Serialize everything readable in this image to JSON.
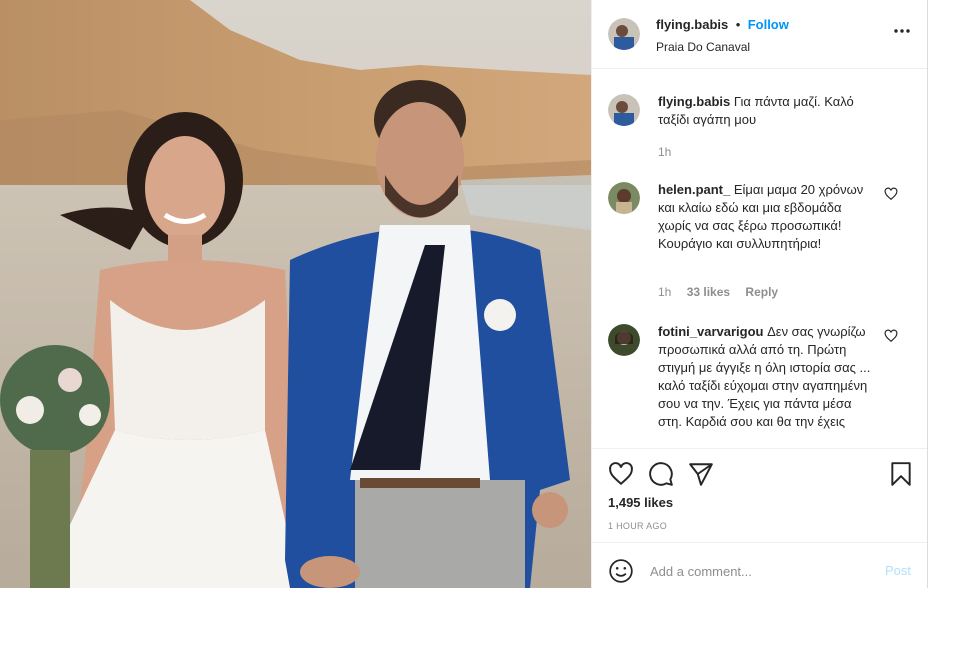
{
  "post": {
    "username": "flying.babis",
    "separator": "•",
    "follow_label": "Follow",
    "location": "Praia Do Canaval",
    "more_icon": "more-horizontal-icon"
  },
  "caption": {
    "username": "flying.babis",
    "text": "Για πάντα μαζί. Καλό ταξίδι αγάπη μου",
    "time": "1h"
  },
  "comments": [
    {
      "username": "helen.pant_",
      "text": "Είμαι μαμα 20 χρόνων και κλαίω εδώ και μια εβδομάδα χωρίς να σας ξέρω προσωπικά! Κουράγιο και συλλυπητήρια!",
      "time": "1h",
      "likes": "33 likes",
      "reply": "Reply"
    },
    {
      "username": "fotini_varvarigou",
      "text": "Δεν σας γνωρίζω προσωπικά αλλά από τη. Πρώτη στιγμή με άγγιξε η όλη ιστορία σας ... καλό ταξίδι εύχομαι στην αγαπημένη σου να την. Έχεις για πάντα μέσα στη. Καρδιά σου και θα την έχεις"
    }
  ],
  "engagement": {
    "likes": "1,495 likes",
    "time_ago": "1 HOUR AGO"
  },
  "add_comment": {
    "placeholder": "Add a comment...",
    "post_label": "Post"
  },
  "colors": {
    "accent": "#0095f6",
    "post_disabled": "#b2dffc",
    "muted": "#8e8e8e",
    "text": "#262626"
  }
}
